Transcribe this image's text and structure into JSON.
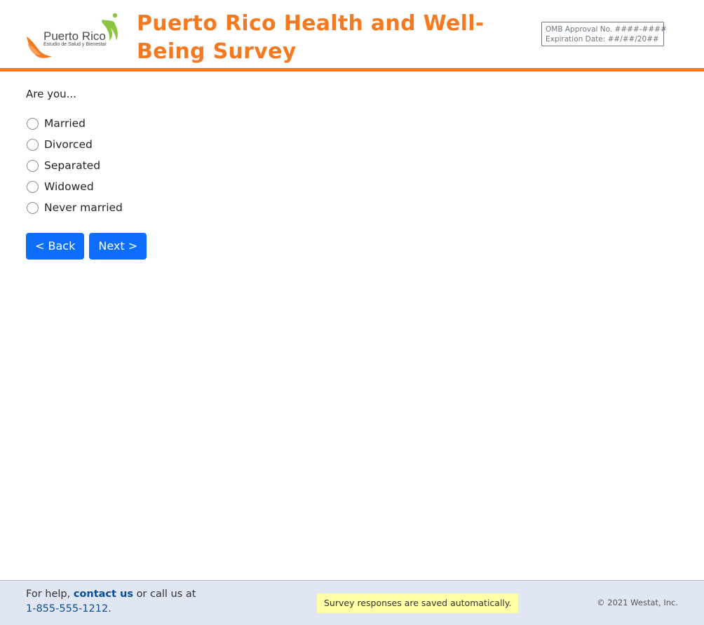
{
  "header": {
    "logo_text": "Puerto Rico",
    "logo_subtext": "Estudio de Salud y Bienestar",
    "title": "Puerto Rico Health and Well-Being Survey",
    "omb_approval": "OMB Approval No. ####-####",
    "expiration": "Expiration Date: ##/##/20##",
    "accent_color": "#f47a21"
  },
  "question": {
    "prompt": "Are you...",
    "options": [
      {
        "label": "Married",
        "selected": false
      },
      {
        "label": "Divorced",
        "selected": false
      },
      {
        "label": "Separated",
        "selected": false
      },
      {
        "label": "Widowed",
        "selected": false
      },
      {
        "label": "Never married",
        "selected": false
      }
    ]
  },
  "nav": {
    "back_label": "< Back",
    "next_label": "Next >",
    "button_color": "#0d6efd"
  },
  "footer": {
    "help_prefix": "For help,",
    "contact_link": "contact us",
    "help_middle": "or call us at",
    "phone": "1-855-555-1212",
    "help_suffix": ".",
    "saved_notice": "Survey responses are saved automatically.",
    "copyright": "© 2021 Westat, Inc."
  }
}
